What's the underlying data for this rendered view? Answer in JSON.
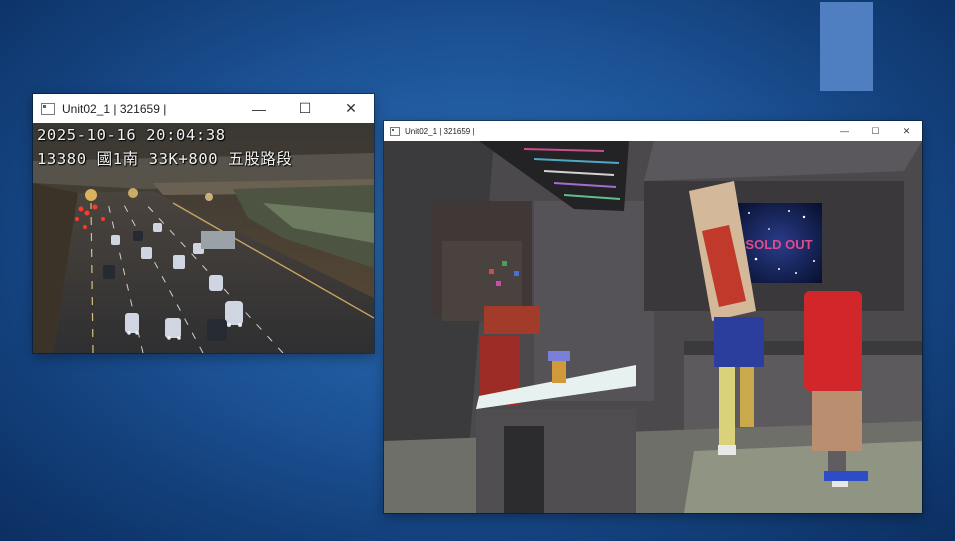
{
  "camera_window": {
    "title": "Unit02_1 | 321659 |",
    "controls": {
      "minimize": "—",
      "maximize": "☐",
      "close": "✕"
    },
    "feed": {
      "timestamp": "2025-10-16  20:04:38",
      "camera_label": "13380  國1南  33K+800  五股路段"
    }
  },
  "game_window": {
    "title": "Unit02_1 | 321659 |",
    "controls": {
      "minimize": "—",
      "maximize": "☐",
      "close": "✕"
    },
    "scene": {
      "poster_text": "SOLD OUT"
    }
  },
  "colors": {
    "desktop_background": "#1d5498",
    "accent_rect": "#4f7fc0",
    "poster_text": "#e04c8a"
  }
}
